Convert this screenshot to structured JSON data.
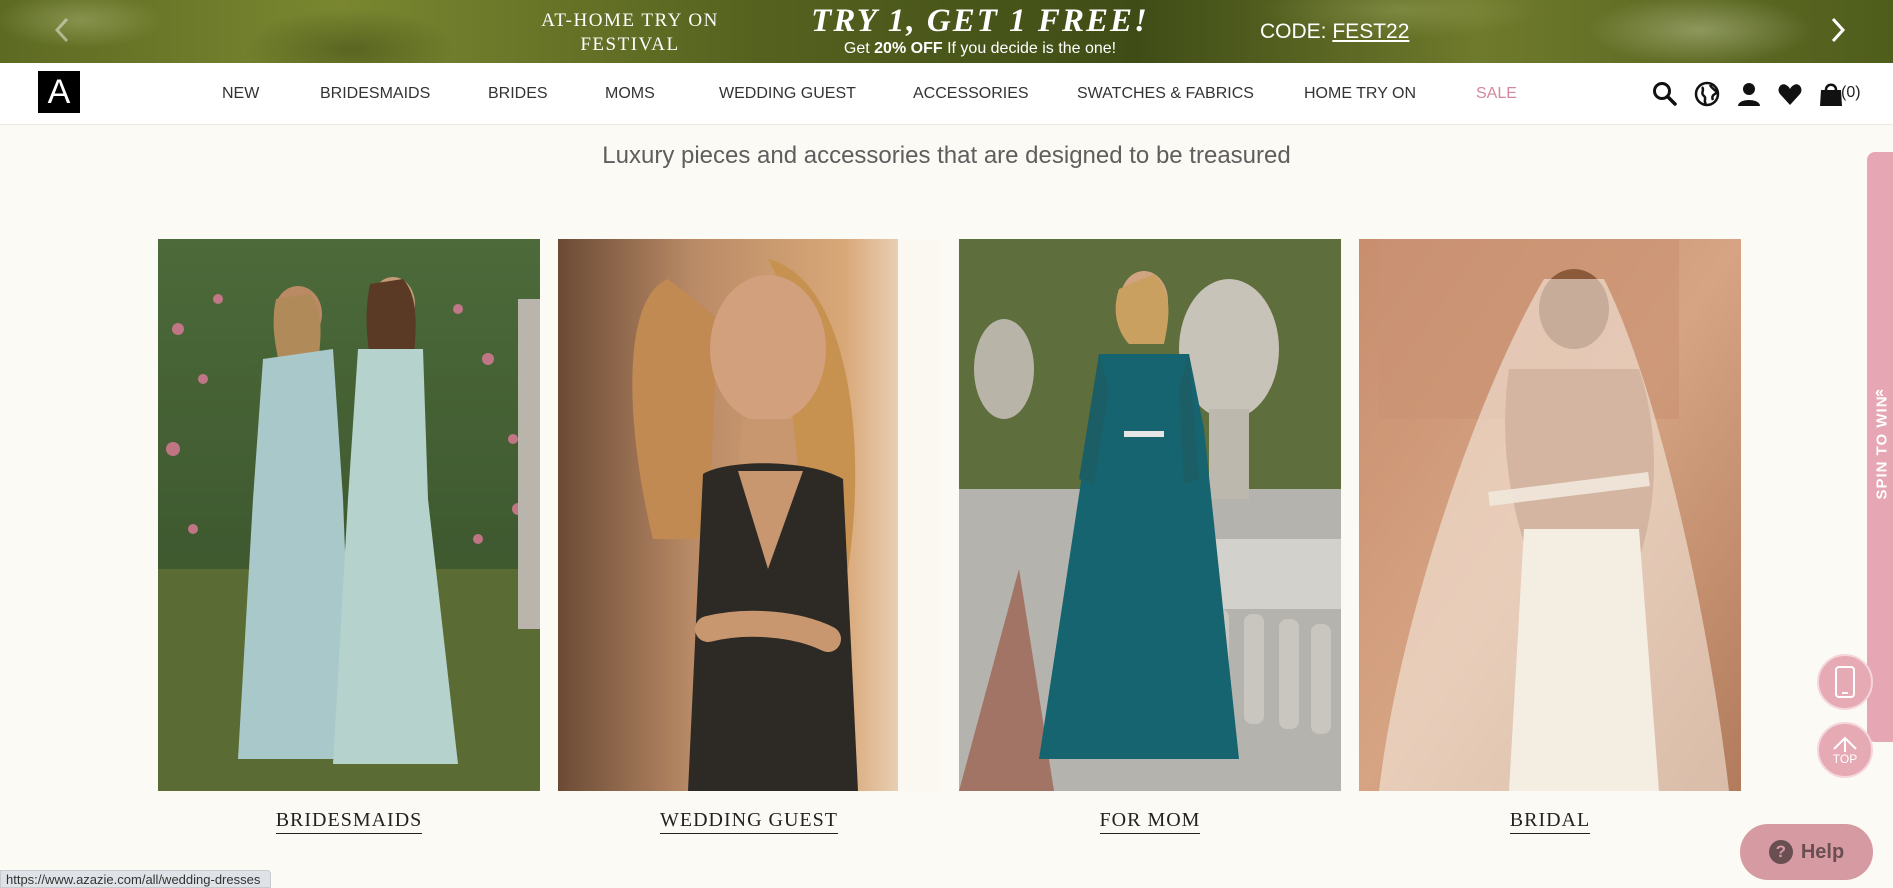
{
  "promo": {
    "home_try_line1": "AT-HOME TRY ON",
    "home_try_line2": "FESTIVAL",
    "headline": "TRY 1, GET 1  FREE!",
    "sub_prefix": "Get",
    "sub_bold": "20% OFF",
    "sub_suffix": "If you decide is the one!",
    "code_label": "CODE:",
    "code_value": "FEST22"
  },
  "logo": {
    "letter": "A"
  },
  "nav": {
    "items": [
      {
        "label": "NEW"
      },
      {
        "label": "BRIDESMAIDS"
      },
      {
        "label": "BRIDES"
      },
      {
        "label": "MOMS"
      },
      {
        "label": "WEDDING GUEST"
      },
      {
        "label": "ACCESSORIES"
      },
      {
        "label": "SWATCHES & FABRICS"
      },
      {
        "label": "HOME TRY ON"
      },
      {
        "label": "SALE"
      }
    ],
    "cart_count": "(0)",
    "icons": [
      "search-icon",
      "globe-icon",
      "account-icon",
      "heart-icon",
      "bag-icon"
    ]
  },
  "tagline": "Luxury pieces and accessories that are designed to be treasured",
  "cards": [
    {
      "label": "BRIDESMAIDS"
    },
    {
      "label": "WEDDING GUEST"
    },
    {
      "label": "FOR MOM"
    },
    {
      "label": "BRIDAL"
    }
  ],
  "side_tab": {
    "label": "SPIN TO WIN",
    "chevron": "«"
  },
  "top_button": {
    "label": "TOP"
  },
  "help": {
    "label": "Help",
    "icon": "?"
  },
  "status_url": "https://www.azazie.com/all/wedding-dresses",
  "colors": {
    "sale": "#d2889d",
    "accent_pink": "#e6a6b3",
    "background": "#fcfaf4"
  }
}
